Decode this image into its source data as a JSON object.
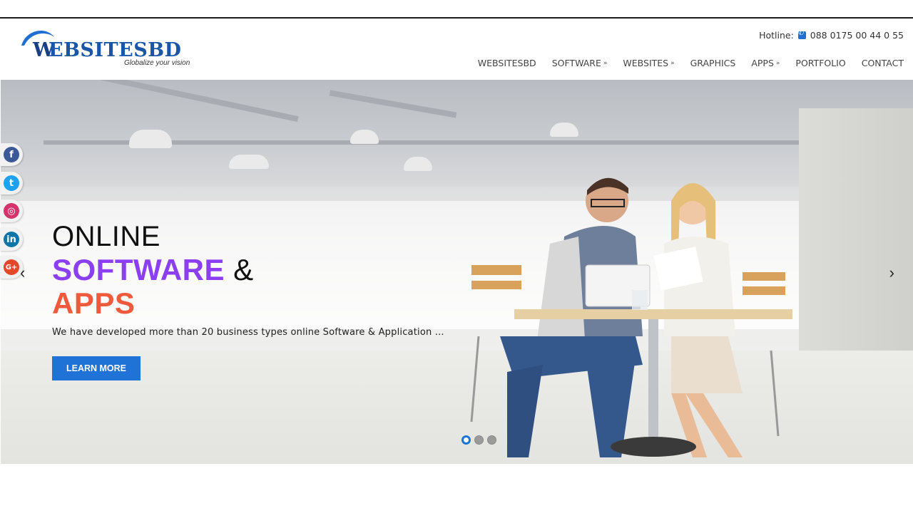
{
  "header": {
    "logo_text": "EBSITESBD",
    "logo_w": "W",
    "tagline": "Globalize your vision",
    "hotline_label": "Hotline:",
    "hotline_number": "088 0175 00 44 0 55"
  },
  "nav": {
    "items": [
      {
        "label": "WEBSITESBD"
      },
      {
        "label": "SOFTWARE",
        "dropdown": "»"
      },
      {
        "label": "WEBSITES",
        "dropdown": "»"
      },
      {
        "label": "GRAPHICS"
      },
      {
        "label": "APPS",
        "dropdown": "»"
      },
      {
        "label": "PORTFOLIO"
      },
      {
        "label": "CONTACT"
      }
    ]
  },
  "hero": {
    "line1": "ONLINE",
    "line2_a": "SOFTWARE",
    "line2_b": "&",
    "line3": "APPS",
    "description": "We have developed more than 20 business types online Software & Application ...",
    "button_label": "LEARN MORE",
    "prev_arrow": "‹",
    "next_arrow": "›",
    "slides": 3,
    "active_slide": 1
  },
  "social": {
    "items": [
      {
        "name": "facebook",
        "glyph": "f"
      },
      {
        "name": "twitter",
        "glyph": "t"
      },
      {
        "name": "instagram",
        "glyph": "◎"
      },
      {
        "name": "linkedin",
        "glyph": "in"
      },
      {
        "name": "google-plus",
        "glyph": "G+"
      }
    ]
  },
  "colors": {
    "accent_blue": "#1f72d6",
    "software_purple": "#8b3ff0",
    "apps_orange": "#f05a3c"
  }
}
